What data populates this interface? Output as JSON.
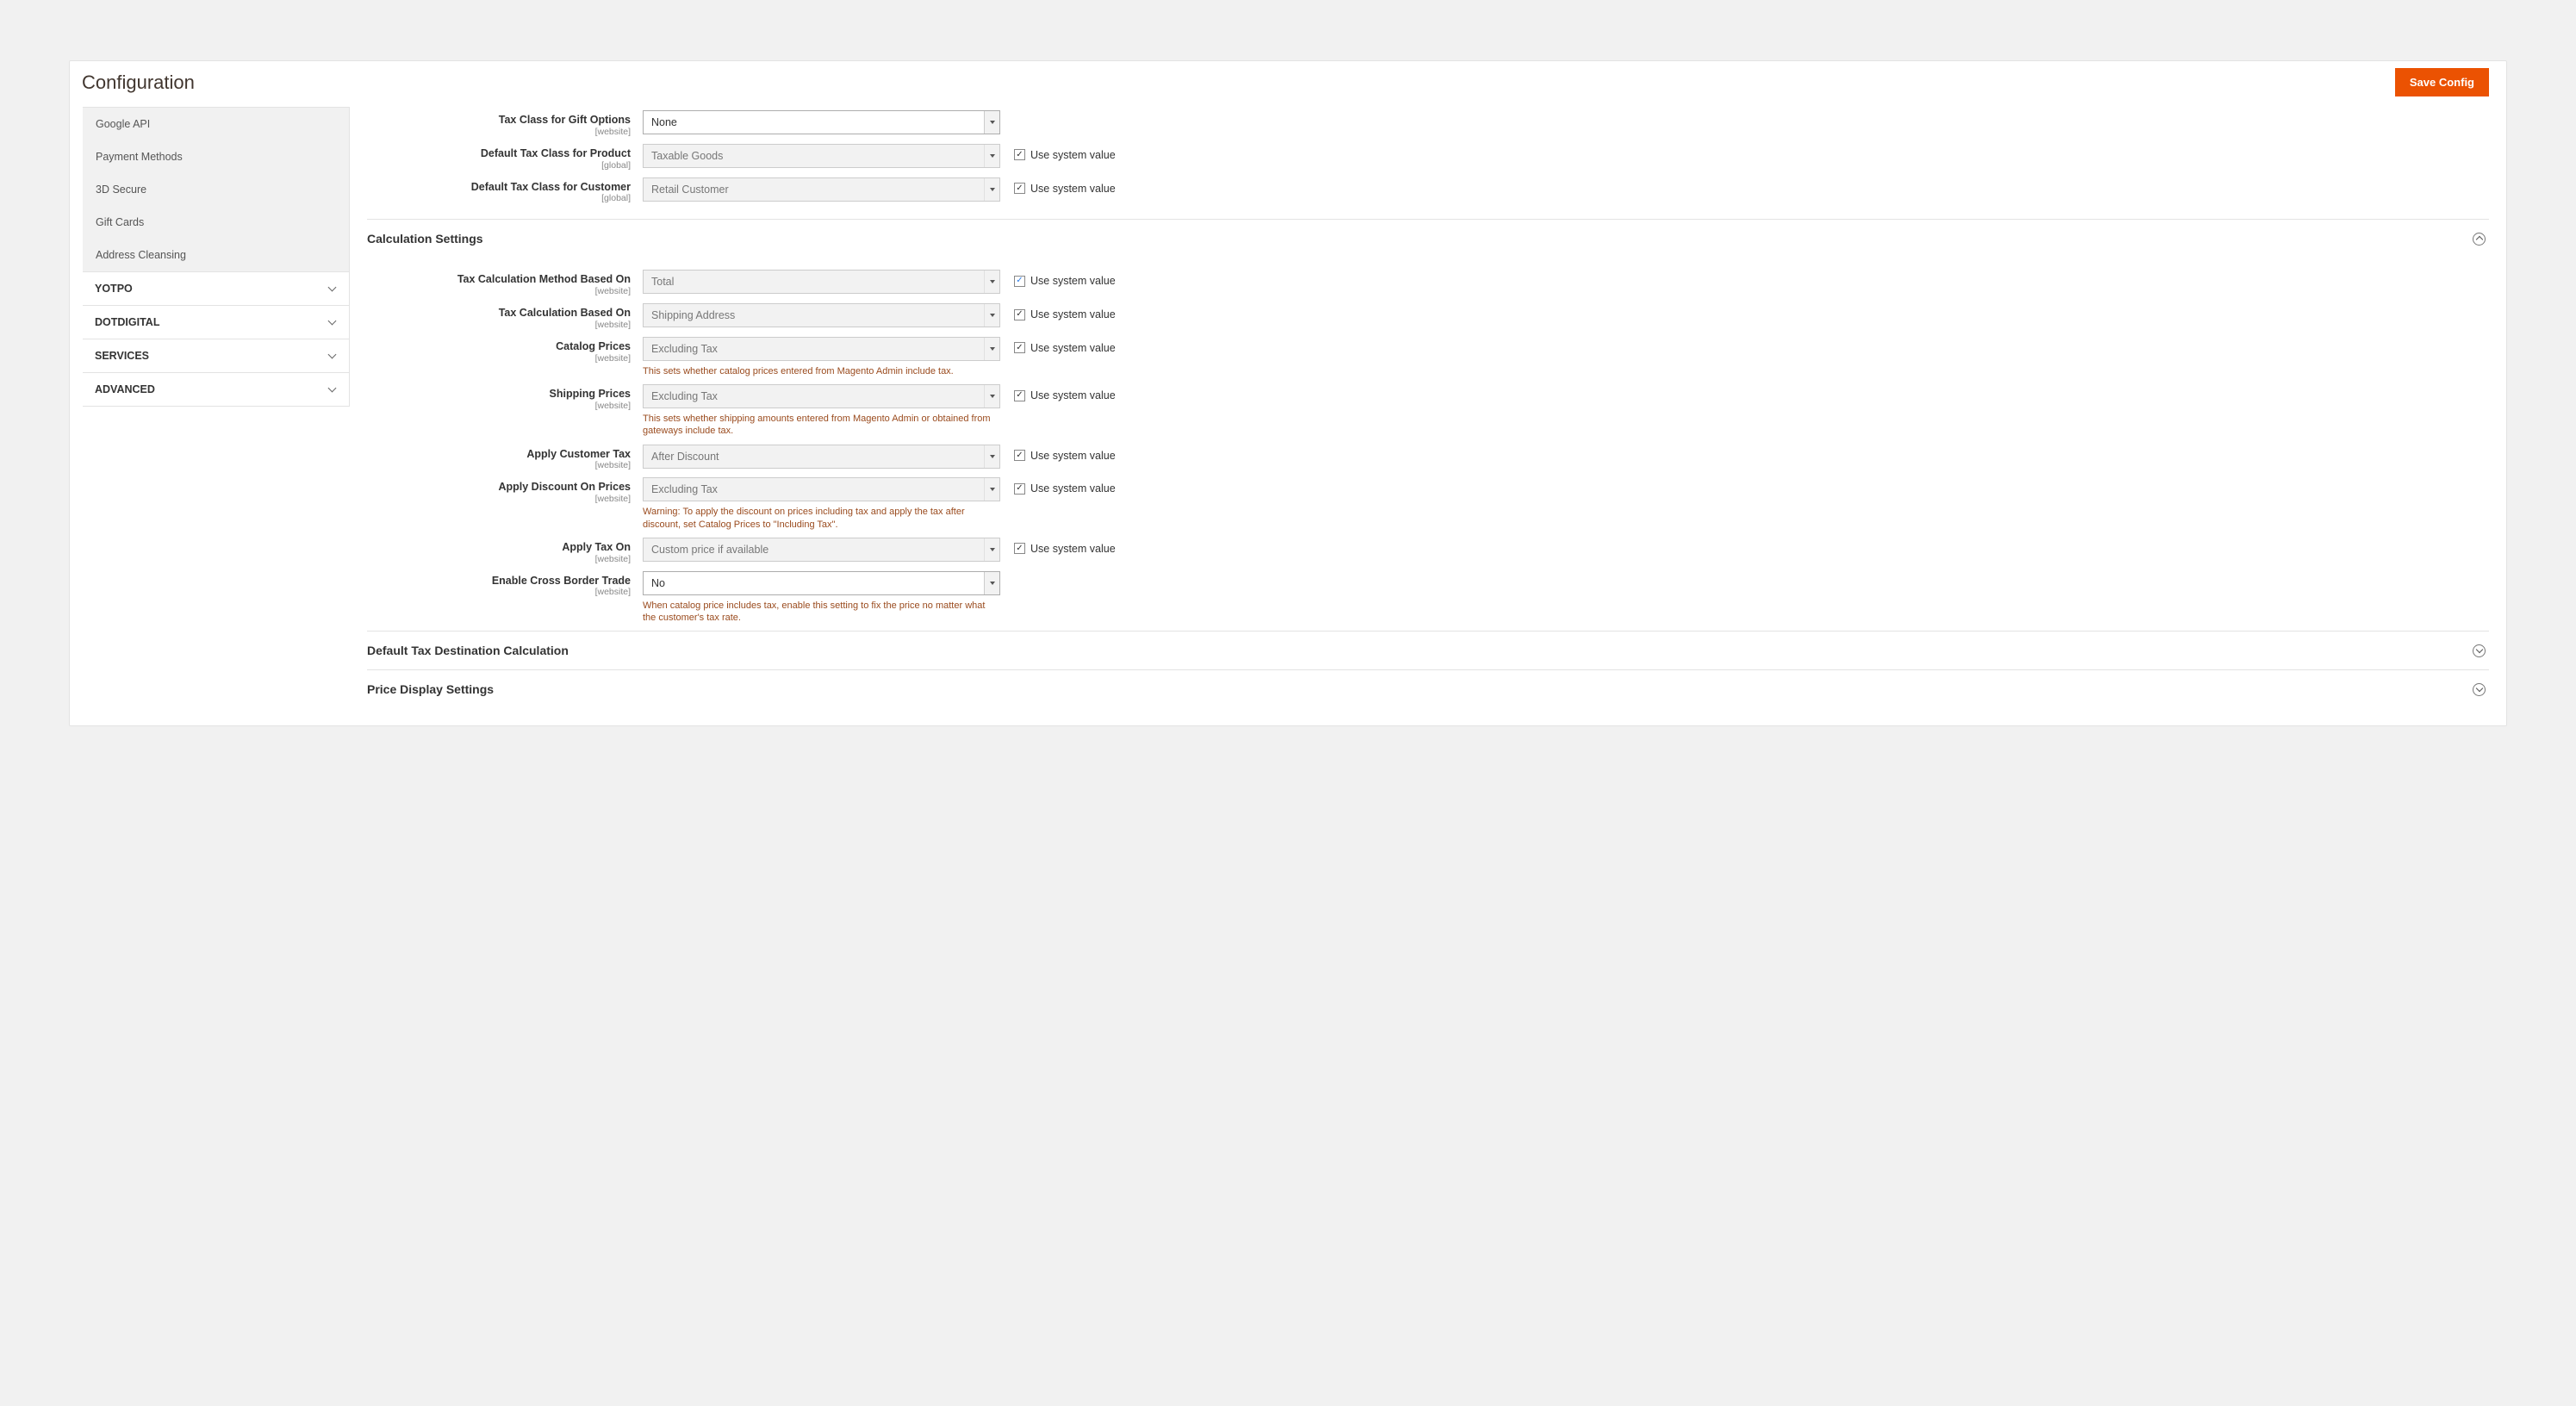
{
  "header": {
    "title": "Configuration",
    "save_button": "Save Config"
  },
  "sidebar": {
    "sub_items": [
      "Google API",
      "Payment Methods",
      "3D Secure",
      "Gift Cards",
      "Address Cleansing"
    ],
    "groups": [
      "YOTPO",
      "DOTDIGITAL",
      "SERVICES",
      "ADVANCED"
    ]
  },
  "use_system_value_label": "Use system value",
  "top_section": {
    "fields": [
      {
        "label": "Tax Class for Gift Options",
        "scope": "[website]",
        "value": "None",
        "disabled": false,
        "use_system": null
      },
      {
        "label": "Default Tax Class for Product",
        "scope": "[global]",
        "value": "Taxable Goods",
        "disabled": true,
        "use_system": true
      },
      {
        "label": "Default Tax Class for Customer",
        "scope": "[global]",
        "value": "Retail Customer",
        "disabled": true,
        "use_system": true
      }
    ]
  },
  "sections": [
    {
      "title": "Calculation Settings",
      "expanded": true,
      "fields": [
        {
          "label": "Tax Calculation Method Based On",
          "scope": "[website]",
          "value": "Total",
          "disabled": true,
          "use_system": true,
          "blue_check": true
        },
        {
          "label": "Tax Calculation Based On",
          "scope": "[website]",
          "value": "Shipping Address",
          "disabled": true,
          "use_system": true
        },
        {
          "label": "Catalog Prices",
          "scope": "[website]",
          "value": "Excluding Tax",
          "disabled": true,
          "use_system": true,
          "help": "This sets whether catalog prices entered from Magento Admin include tax."
        },
        {
          "label": "Shipping Prices",
          "scope": "[website]",
          "value": "Excluding Tax",
          "disabled": true,
          "use_system": true,
          "help": "This sets whether shipping amounts entered from Magento Admin or obtained from gateways include tax."
        },
        {
          "label": "Apply Customer Tax",
          "scope": "[website]",
          "value": "After Discount",
          "disabled": true,
          "use_system": true
        },
        {
          "label": "Apply Discount On Prices",
          "scope": "[website]",
          "value": "Excluding Tax",
          "disabled": true,
          "use_system": true,
          "help": "Warning: To apply the discount on prices including tax and apply the tax after discount, set Catalog Prices to \"Including Tax\"."
        },
        {
          "label": "Apply Tax On",
          "scope": "[website]",
          "value": "Custom price if available",
          "disabled": true,
          "use_system": true
        },
        {
          "label": "Enable Cross Border Trade",
          "scope": "[website]",
          "value": "No",
          "disabled": false,
          "use_system": null,
          "help": "When catalog price includes tax, enable this setting to fix the price no matter what the customer's tax rate."
        }
      ]
    },
    {
      "title": "Default Tax Destination Calculation",
      "expanded": false
    },
    {
      "title": "Price Display Settings",
      "expanded": false
    }
  ]
}
